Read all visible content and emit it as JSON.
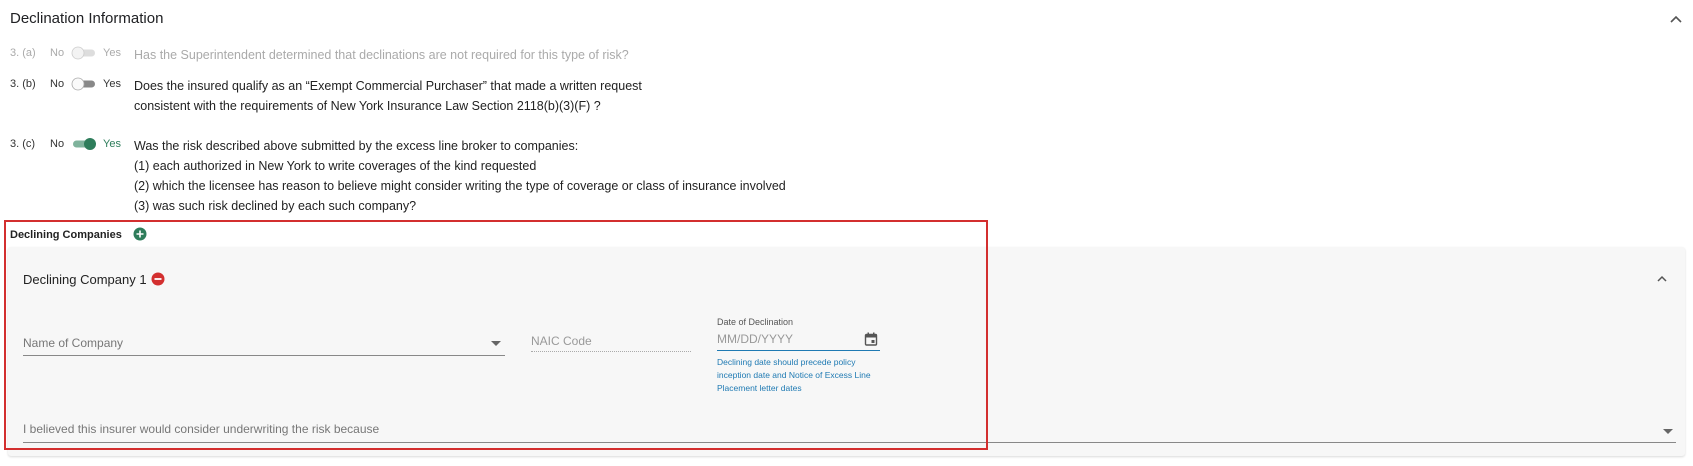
{
  "section": {
    "title": "Declination Information"
  },
  "questions": [
    {
      "num": "3. (a)",
      "no": "No",
      "yes": "Yes",
      "state": "disabled",
      "lines": [
        "Has the Superintendent determined that declinations are not required for this type of risk?"
      ]
    },
    {
      "num": "3. (b)",
      "no": "No",
      "yes": "Yes",
      "state": "off",
      "lines": [
        "Does the insured qualify as an “Exempt Commercial Purchaser” that made a written request",
        "consistent with the requirements of New York Insurance Law Section 2118(b)(3)(F) ?"
      ]
    },
    {
      "num": "3. (c)",
      "no": "No",
      "yes": "Yes",
      "state": "on",
      "lines": [
        "Was the risk described above submitted by the excess line broker to companies:",
        "(1) each authorized in New York to write coverages of the kind requested",
        "(2) which the licensee has reason to believe might consider writing the type of coverage or class of insurance involved",
        "(3) was such risk declined by each such company?"
      ]
    }
  ],
  "declining": {
    "header": "Declining Companies",
    "company": {
      "title": "Declining Company 1",
      "name_placeholder": "Name of Company",
      "naic_placeholder": "NAIC Code",
      "date_label": "Date of Declination",
      "date_placeholder": "MM/DD/YYYY",
      "date_helper": [
        "Declining date should precede policy",
        "inception date and Notice of Excess Line",
        "Placement letter dates"
      ],
      "reason_placeholder": "I believed this insurer would consider underwriting the risk because"
    }
  },
  "colors": {
    "accent_green": "#2e7d5b",
    "remove_red": "#d32f2f",
    "highlight_red": "#d32f2f",
    "helper_blue": "#1f7ab3"
  }
}
